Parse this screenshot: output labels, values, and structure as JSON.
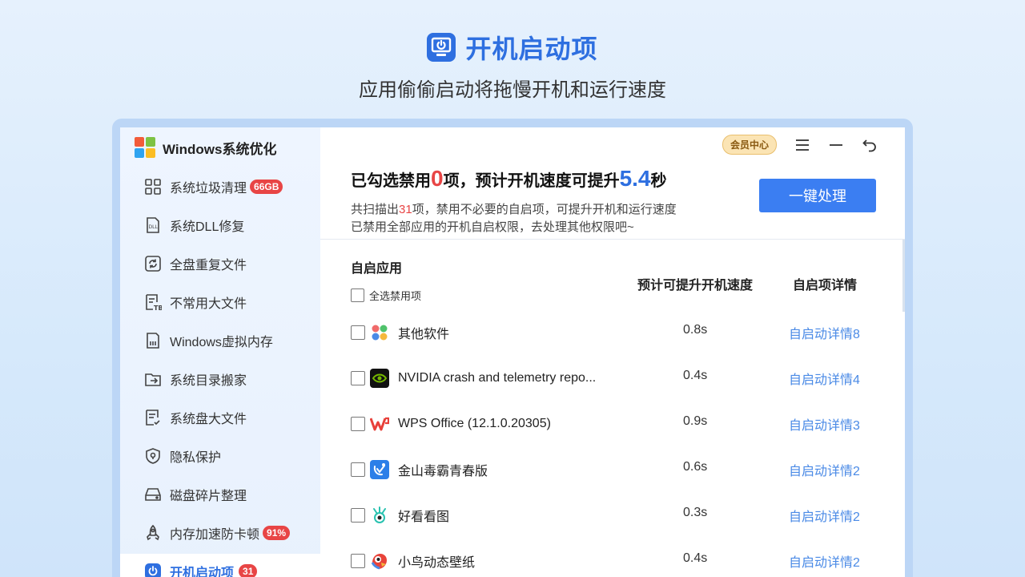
{
  "hero": {
    "title": "开机启动项",
    "subtitle": "应用偷偷启动将拖慢开机和运行速度"
  },
  "brand": {
    "name": "Windows系统优化"
  },
  "sidebar": {
    "items": [
      {
        "label": "系统垃圾清理",
        "icon": "grid-icon",
        "badge": "66GB"
      },
      {
        "label": "系统DLL修复",
        "icon": "dll-file-icon",
        "badge": ""
      },
      {
        "label": "全盘重复文件",
        "icon": "refresh-icon",
        "badge": ""
      },
      {
        "label": "不常用大文件",
        "icon": "tb-file-icon",
        "badge": ""
      },
      {
        "label": "Windows虚拟内存",
        "icon": "memory-card-icon",
        "badge": ""
      },
      {
        "label": "系统目录搬家",
        "icon": "folder-move-icon",
        "badge": ""
      },
      {
        "label": "系统盘大文件",
        "icon": "document-list-icon",
        "badge": ""
      },
      {
        "label": "隐私保护",
        "icon": "shield-icon",
        "badge": ""
      },
      {
        "label": "磁盘碎片整理",
        "icon": "disk-icon",
        "badge": ""
      },
      {
        "label": "内存加速防卡顿",
        "icon": "rocket-icon",
        "badge": "91%"
      },
      {
        "label": "开机启动项",
        "icon": "power-icon",
        "badge": "31"
      }
    ]
  },
  "topbar": {
    "vip_label": "会员中心"
  },
  "summary": {
    "prefix": "已勾选禁用",
    "count": "0",
    "middle": "项，预计开机速度可提升",
    "speedup": "5.4",
    "suffix": "秒",
    "desc1_prefix": "共扫描出",
    "desc1_count": "31",
    "desc1_suffix": "项，禁用不必要的自启项，可提升开机和运行速度",
    "desc2": "已禁用全部应用的开机自启权限，去处理其他权限吧~",
    "action_label": "一键处理"
  },
  "table": {
    "title": "自启应用",
    "select_all_label": "全选禁用项",
    "speed_header": "预计可提升开机速度",
    "detail_header": "自启项详情",
    "rows": [
      {
        "name": "其他软件",
        "speed": "0.8s",
        "detail": "自启动详情8",
        "icon": "apps-grid-icon"
      },
      {
        "name": "NVIDIA crash and telemetry repo...",
        "speed": "0.4s",
        "detail": "自启动详情4",
        "icon": "nvidia-icon"
      },
      {
        "name": "WPS Office (12.1.0.20305)",
        "speed": "0.9s",
        "detail": "自启动详情3",
        "icon": "wps-icon"
      },
      {
        "name": "金山毒霸青春版",
        "speed": "0.6s",
        "detail": "自启动详情2",
        "icon": "duba-icon"
      },
      {
        "name": "好看看图",
        "speed": "0.3s",
        "detail": "自启动详情2",
        "icon": "eye-viewer-icon"
      },
      {
        "name": "小鸟动态壁纸",
        "speed": "0.4s",
        "detail": "自启动详情2",
        "icon": "bird-wallpaper-icon"
      }
    ]
  },
  "colors": {
    "accent": "#2e6fe0",
    "danger": "#e84545",
    "link": "#4a8ae6"
  }
}
